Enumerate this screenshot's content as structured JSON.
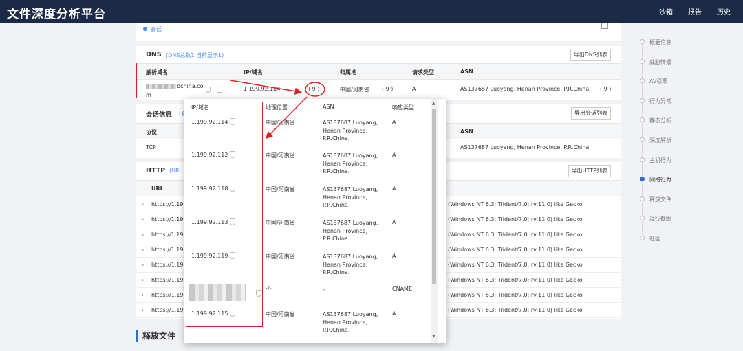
{
  "app": {
    "title": "文件深度分析平台"
  },
  "topnav": [
    "沙箱",
    "报告",
    "历史"
  ],
  "session_link": "会话",
  "dns": {
    "title": "DNS",
    "subtitle": "(DNS总数1,当前显示1)",
    "export_label": "导出DNS列表",
    "headers": [
      "解析域名",
      "IP/域名",
      "归属地",
      "请求类型",
      "ASN"
    ],
    "row": {
      "domain_line1": "bchina.co",
      "domain_line2": "m",
      "ip": "1.199.92.114",
      "count": "( 9 )",
      "location": "中国/河南省",
      "location_count": "( 9 )",
      "type": "A",
      "asn": "AS137687 Luoyang, Henan Province, P.R.China.",
      "asn_count": "( 9 )"
    }
  },
  "session": {
    "title": "会话信息",
    "subtitle": "(会",
    "export_label": "导出会话列表",
    "headers": [
      "协议",
      "ASN"
    ],
    "row": {
      "protocol": "TCP",
      "asn": "AS137687 Luoyang, Henan Province, P.R.China."
    }
  },
  "http": {
    "title": "HTTP",
    "subtitle": "(URL",
    "export_label": "导出HTTP列表",
    "header_url": "URL",
    "rows": [
      {
        "url": "https://1.199",
        "ua": "(Windows NT 6.3; Trident/7.0; rv:11.0) like Gecko"
      },
      {
        "url": "https://1.199",
        "ua": "(Windows NT 6.3; Trident/7.0; rv:11.0) like Gecko"
      },
      {
        "url": "https://1.199",
        "ua": "(Windows NT 6.3; Trident/7.0; rv:11.0) like Gecko"
      },
      {
        "url": "https://1.199",
        "ua": "(Windows NT 6.3; Trident/7.0; rv:11.0) like Gecko"
      },
      {
        "url": "https://1.199",
        "ua": "(Windows NT 6.3; Trident/7.0; rv:11.0) like Gecko"
      },
      {
        "url": "https://1.199",
        "ua": "(Windows NT 6.3; Trident/7.0; rv:11.0) like Gecko"
      },
      {
        "url": "https://1.199",
        "ua": "(Windows NT 6.3; Trident/7.0; rv:11.0) like Gecko"
      },
      {
        "url": "https://1.199",
        "ua": "(Windows NT 6.3; Trident/7.0; rv:11.0) like Gecko"
      }
    ]
  },
  "release_files_title": "释放文件",
  "popup": {
    "headers": [
      "IP/域名",
      "地理位置",
      "ASN",
      "响应类型"
    ],
    "rows": [
      {
        "ip": "1.199.92.114",
        "loc": "中国/河南省",
        "asn": "AS137687 Luoyang, Henan Province, P.R.China.",
        "type": "A"
      },
      {
        "ip": "1.199.92.112",
        "loc": "中国/河南省",
        "asn": "AS137687 Luoyang, Henan Province, P.R.China.",
        "type": "A"
      },
      {
        "ip": "1.199.92.118",
        "loc": "中国/河南省",
        "asn": "AS137687 Luoyang, Henan Province, P.R.China.",
        "type": "A"
      },
      {
        "ip": "1.199.92.113",
        "loc": "中国/河南省",
        "asn": "AS137687 Luoyang, Henan Province, P.R.China.",
        "type": "A"
      },
      {
        "ip": "1.199.92.119",
        "loc": "中国/河南省",
        "asn": "AS137687 Luoyang, Henan Province, P.R.China.",
        "type": "A"
      },
      {
        "ip": "",
        "loc": "-/-",
        "asn": "-",
        "type": "CNAME"
      },
      {
        "ip": "1.199.92.115",
        "loc": "中国/河南省",
        "asn": "AS137687 Luoyang, Henan Province, P.R.China.",
        "type": "A"
      }
    ]
  },
  "rightnav": {
    "items": [
      "概要信息",
      "威胁情报",
      "AV引擎",
      "行为异常",
      "静态分析",
      "深度解析",
      "主机行为",
      "网络行为",
      "释放文件",
      "运行截图",
      "社区"
    ],
    "active": "网络行为"
  },
  "colors": {
    "accent": "#4a90e2",
    "topbar": "#1b2a47",
    "annotation": "#e02020"
  }
}
